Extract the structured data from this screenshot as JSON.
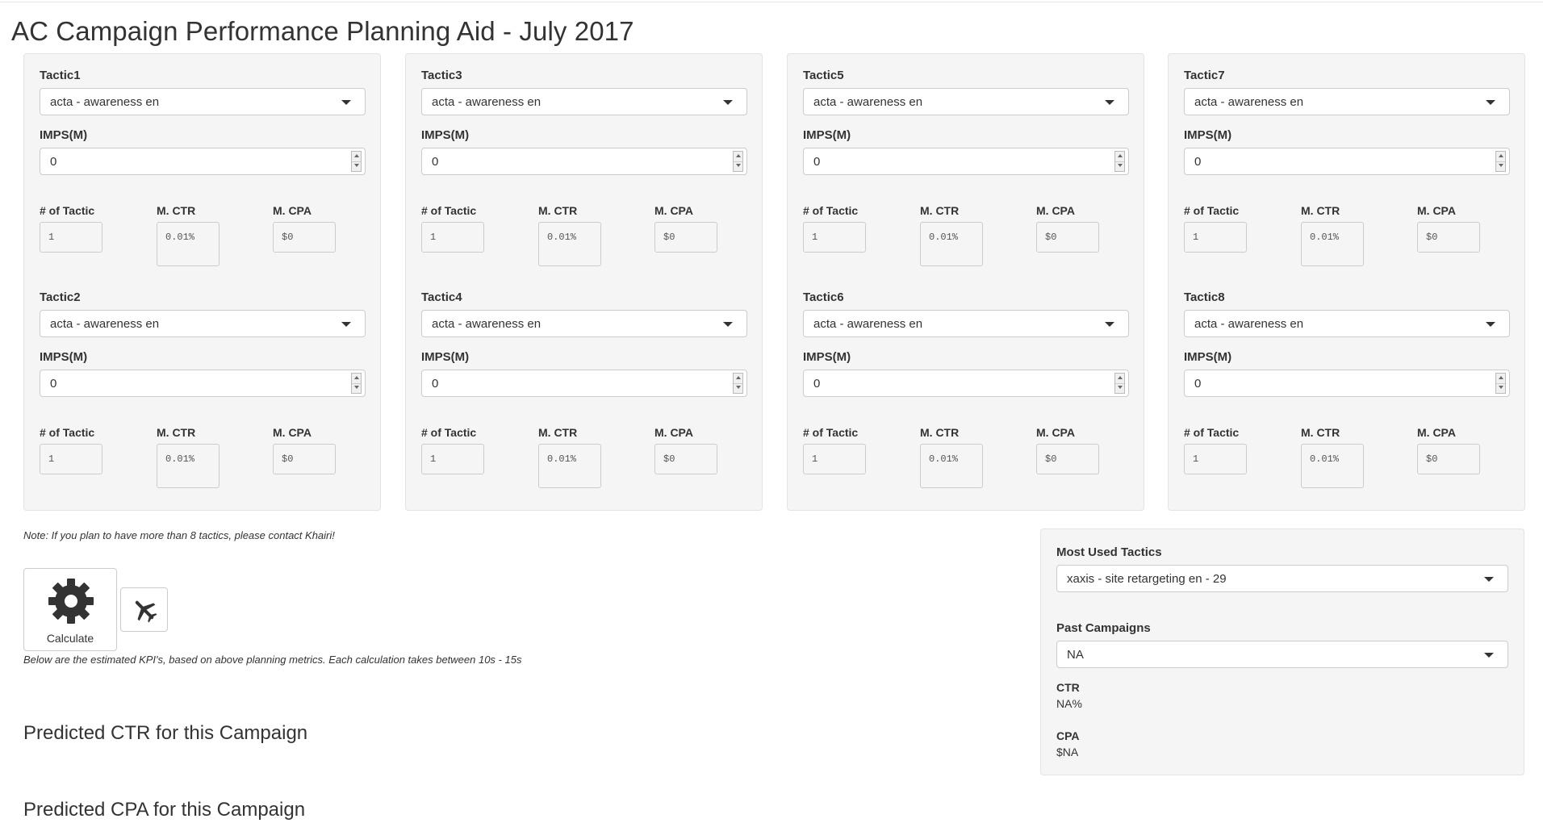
{
  "page": {
    "title": "AC Campaign Performance Planning Aid - July 2017"
  },
  "panels": [
    {
      "tactics": [
        {
          "label": "Tactic1",
          "selected": "acta - awareness en",
          "imps_label": "IMPS(M)",
          "imps_value": "0",
          "metrics": {
            "count_label": "# of Tactic",
            "count": "1",
            "ctr_label": "M. CTR",
            "ctr": "0.01%",
            "cpa_label": "M. CPA",
            "cpa": "$0"
          }
        },
        {
          "label": "Tactic2",
          "selected": "acta - awareness en",
          "imps_label": "IMPS(M)",
          "imps_value": "0",
          "metrics": {
            "count_label": "# of Tactic",
            "count": "1",
            "ctr_label": "M. CTR",
            "ctr": "0.01%",
            "cpa_label": "M. CPA",
            "cpa": "$0"
          }
        }
      ]
    },
    {
      "tactics": [
        {
          "label": "Tactic3",
          "selected": "acta - awareness en",
          "imps_label": "IMPS(M)",
          "imps_value": "0",
          "metrics": {
            "count_label": "# of Tactic",
            "count": "1",
            "ctr_label": "M. CTR",
            "ctr": "0.01%",
            "cpa_label": "M. CPA",
            "cpa": "$0"
          }
        },
        {
          "label": "Tactic4",
          "selected": "acta - awareness en",
          "imps_label": "IMPS(M)",
          "imps_value": "0",
          "metrics": {
            "count_label": "# of Tactic",
            "count": "1",
            "ctr_label": "M. CTR",
            "ctr": "0.01%",
            "cpa_label": "M. CPA",
            "cpa": "$0"
          }
        }
      ]
    },
    {
      "tactics": [
        {
          "label": "Tactic5",
          "selected": "acta - awareness en",
          "imps_label": "IMPS(M)",
          "imps_value": "0",
          "metrics": {
            "count_label": "# of Tactic",
            "count": "1",
            "ctr_label": "M. CTR",
            "ctr": "0.01%",
            "cpa_label": "M. CPA",
            "cpa": "$0"
          }
        },
        {
          "label": "Tactic6",
          "selected": "acta - awareness en",
          "imps_label": "IMPS(M)",
          "imps_value": "0",
          "metrics": {
            "count_label": "# of Tactic",
            "count": "1",
            "ctr_label": "M. CTR",
            "ctr": "0.01%",
            "cpa_label": "M. CPA",
            "cpa": "$0"
          }
        }
      ]
    },
    {
      "tactics": [
        {
          "label": "Tactic7",
          "selected": "acta - awareness en",
          "imps_label": "IMPS(M)",
          "imps_value": "0",
          "metrics": {
            "count_label": "# of Tactic",
            "count": "1",
            "ctr_label": "M. CTR",
            "ctr": "0.01%",
            "cpa_label": "M. CPA",
            "cpa": "$0"
          }
        },
        {
          "label": "Tactic8",
          "selected": "acta - awareness en",
          "imps_label": "IMPS(M)",
          "imps_value": "0",
          "metrics": {
            "count_label": "# of Tactic",
            "count": "1",
            "ctr_label": "M. CTR",
            "ctr": "0.01%",
            "cpa_label": "M. CPA",
            "cpa": "$0"
          }
        }
      ]
    }
  ],
  "note": "Note: If you plan to have more than 8 tactics, please contact Khairi!",
  "actions": {
    "calculate_label": "Calculate",
    "calculate_icon": "gear-icon",
    "plane_icon": "airplane-icon"
  },
  "below_text": "Below are the estimated KPI's, based on above planning metrics. Each calculation takes between 10s - 15s",
  "predicted": {
    "ctr_heading": "Predicted CTR for this Campaign",
    "cpa_heading": "Predicted CPA for this Campaign"
  },
  "side": {
    "most_used_label": "Most Used Tactics",
    "most_used_selected": "xaxis - site retargeting en - 29",
    "past_label": "Past Campaigns",
    "past_selected": "NA",
    "ctr_label": "CTR",
    "ctr_value": "NA%",
    "cpa_label": "CPA",
    "cpa_value": "$NA"
  }
}
